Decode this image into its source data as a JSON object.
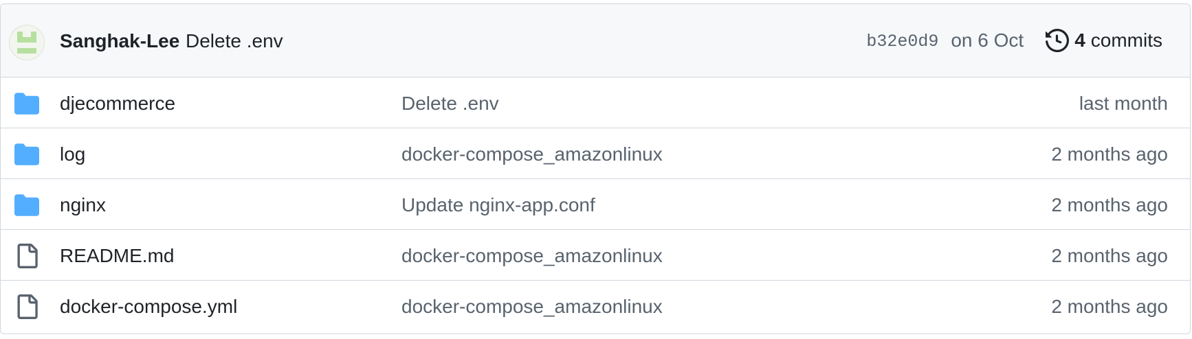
{
  "latest_commit": {
    "author": "Sanghak-Lee",
    "message": "Delete .env",
    "sha": "b32e0d9",
    "date": "on 6 Oct",
    "commits_count": "4",
    "commits_label": "commits",
    "history_icon": "history-icon"
  },
  "files": [
    {
      "type": "directory",
      "icon": "folder-icon",
      "name": "djecommerce",
      "message": "Delete .env",
      "age": "last month"
    },
    {
      "type": "directory",
      "icon": "folder-icon",
      "name": "log",
      "message": "docker-compose_amazonlinux",
      "age": "2 months ago"
    },
    {
      "type": "directory",
      "icon": "folder-icon",
      "name": "nginx",
      "message": "Update nginx-app.conf",
      "age": "2 months ago"
    },
    {
      "type": "file",
      "icon": "file-icon",
      "name": "README.md",
      "message": "docker-compose_amazonlinux",
      "age": "2 months ago"
    },
    {
      "type": "file",
      "icon": "file-icon",
      "name": "docker-compose.yml",
      "message": "docker-compose_amazonlinux",
      "age": "2 months ago"
    }
  ],
  "colors": {
    "folder": "#54aeff",
    "file_icon": "#59636e",
    "header_bg": "#f6f8fa",
    "border": "#d0d7de",
    "muted_text": "#59636e",
    "avatar_green": "#b7dfa0"
  }
}
